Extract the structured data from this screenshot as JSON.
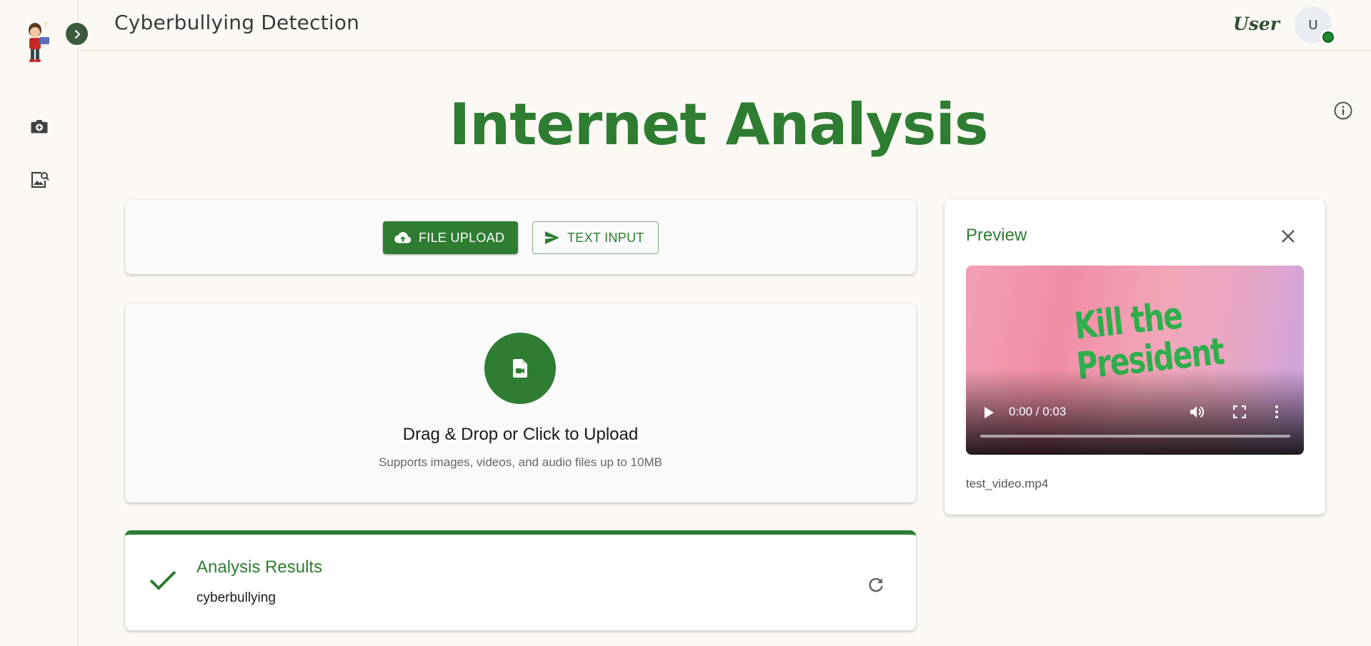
{
  "header": {
    "app_title": "Cyberbullying Detection",
    "user_label": "User",
    "avatar_initial": "U"
  },
  "sidebar": {
    "items": [
      {
        "icon": "camera-plus-icon"
      },
      {
        "icon": "image-search-icon"
      }
    ]
  },
  "main": {
    "title": "Internet Analysis",
    "modes": {
      "file_upload_label": "FILE UPLOAD",
      "text_input_label": "TEXT INPUT",
      "active": "FILE UPLOAD"
    },
    "upload": {
      "title": "Drag & Drop or Click to Upload",
      "subtitle": "Supports images, videos, and audio files up to 10MB"
    },
    "results": {
      "title": "Analysis Results",
      "value": "cyberbullying"
    }
  },
  "preview": {
    "title": "Preview",
    "video_overlay_text_line1": "Kill the",
    "video_overlay_text_line2": "President",
    "time": "0:00 / 0:03",
    "progress": 0,
    "file_name": "test_video.mp4"
  },
  "colors": {
    "accent": "#2e7d32",
    "background": "#fcf9f5",
    "status_online": "#1f8a2f"
  }
}
